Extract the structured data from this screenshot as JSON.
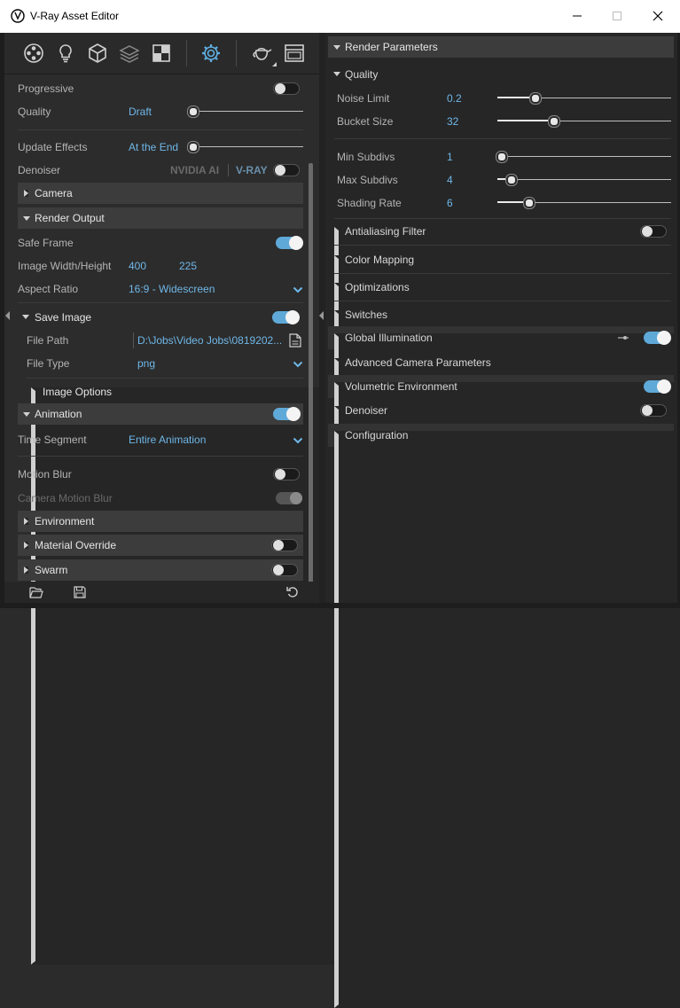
{
  "window": {
    "title": "V-Ray Asset Editor",
    "controls": [
      "minimize",
      "maximize",
      "close"
    ]
  },
  "toolbar": {
    "icons": [
      "materials-icon",
      "lights-icon",
      "geometry-icon",
      "layers-icon",
      "textures-icon",
      "settings-icon",
      "render-teapot-icon",
      "frame-buffer-icon"
    ]
  },
  "left": {
    "progressive": {
      "label": "Progressive",
      "on": false
    },
    "quality": {
      "label": "Quality",
      "value": "Draft",
      "level": 0
    },
    "update_effects": {
      "label": "Update Effects",
      "value": "At the End",
      "level": 0
    },
    "denoiser": {
      "label": "Denoiser",
      "opt1": "NVIDIA AI",
      "opt2": "V-RAY",
      "on": false
    },
    "camera": {
      "label": "Camera",
      "expanded": false
    },
    "render_output": {
      "label": "Render Output",
      "expanded": true
    },
    "safe_frame": {
      "label": "Safe Frame",
      "on": true
    },
    "image_size": {
      "label": "Image Width/Height",
      "width": "400",
      "height": "225"
    },
    "aspect_ratio": {
      "label": "Aspect Ratio",
      "value": "16:9 - Widescreen"
    },
    "save_image": {
      "label": "Save Image",
      "expanded": true,
      "on": true
    },
    "file_path": {
      "label": "File Path",
      "value": "D:\\Jobs\\Video Jobs\\0819202..."
    },
    "file_type": {
      "label": "File Type",
      "value": "png"
    },
    "image_options": {
      "label": "Image Options",
      "expanded": false
    },
    "animation": {
      "label": "Animation",
      "expanded": true,
      "on": true
    },
    "time_segment": {
      "label": "Time Segment",
      "value": "Entire Animation"
    },
    "motion_blur": {
      "label": "Motion Blur",
      "on": false
    },
    "camera_motion_blur": {
      "label": "Camera Motion Blur",
      "on": true,
      "disabled": true
    },
    "environment": {
      "label": "Environment",
      "expanded": false
    },
    "material_override": {
      "label": "Material Override",
      "expanded": false,
      "on": false
    },
    "swarm": {
      "label": "Swarm",
      "expanded": false,
      "on": false
    }
  },
  "footer": {
    "icons": [
      "open-folder-icon",
      "save-icon",
      "reset-icon"
    ]
  },
  "right": {
    "header": "Render Parameters",
    "quality": {
      "label": "Quality",
      "expanded": true
    },
    "noise_limit": {
      "label": "Noise Limit",
      "value": "0.2",
      "level": 0.2
    },
    "bucket_size": {
      "label": "Bucket Size",
      "value": "32",
      "level": 0.33
    },
    "min_subdivs": {
      "label": "Min Subdivs",
      "value": "1",
      "level": 0.0
    },
    "max_subdivs": {
      "label": "Max Subdivs",
      "value": "4",
      "level": 0.06
    },
    "shading_rate": {
      "label": "Shading Rate",
      "value": "6",
      "level": 0.18
    },
    "sections": [
      {
        "label": "Antialiasing Filter",
        "toggle": false
      },
      {
        "label": "Color Mapping"
      },
      {
        "label": "Optimizations"
      },
      {
        "label": "Switches"
      },
      {
        "label": "Global Illumination",
        "toggle": true,
        "extra_icon": "link-icon"
      },
      {
        "label": "Advanced Camera Parameters"
      },
      {
        "label": "Volumetric Environment",
        "toggle": true
      },
      {
        "label": "Denoiser",
        "toggle": false
      },
      {
        "label": "Configuration"
      }
    ]
  }
}
